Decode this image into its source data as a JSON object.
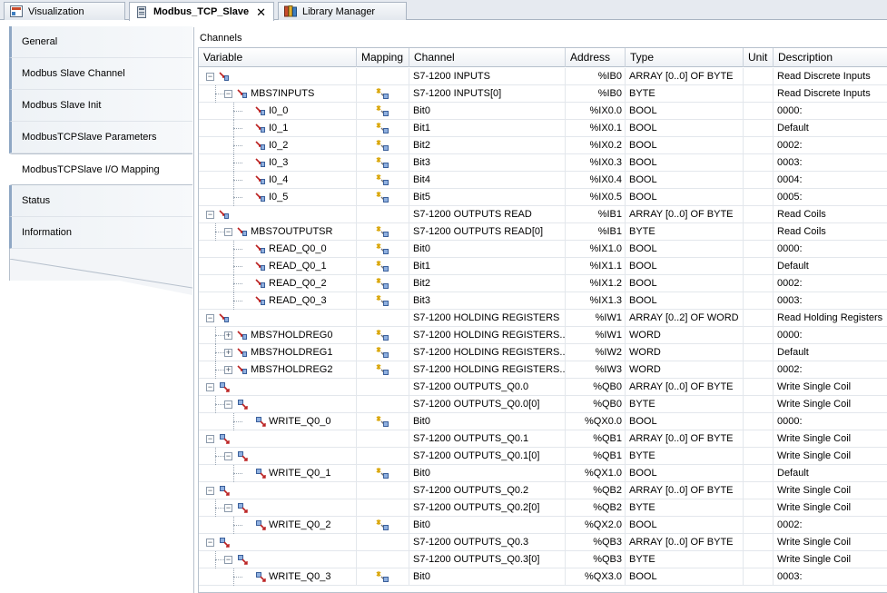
{
  "tabs": [
    {
      "label": "Visualization",
      "icon": "visualization-icon",
      "active": false
    },
    {
      "label": "Modbus_TCP_Slave",
      "icon": "device-icon",
      "active": true
    },
    {
      "label": "Library Manager",
      "icon": "library-icon",
      "active": false
    }
  ],
  "nav": [
    {
      "label": "General"
    },
    {
      "label": "Modbus Slave Channel"
    },
    {
      "label": "Modbus Slave Init"
    },
    {
      "label": "ModbusTCPSlave Parameters"
    },
    {
      "label": "ModbusTCPSlave I/O Mapping"
    },
    {
      "label": "Status"
    },
    {
      "label": "Information"
    }
  ],
  "section_title": "Channels",
  "columns": {
    "variable": "Variable",
    "mapping": "Mapping",
    "channel": "Channel",
    "address": "Address",
    "type": "Type",
    "unit": "Unit",
    "description": "Description"
  },
  "rows": [
    {
      "level": 0,
      "expander": "minus",
      "icon": "input",
      "var": "",
      "map": false,
      "channel": "S7-1200 INPUTS",
      "address": "%IB0",
      "type": "ARRAY [0..0] OF BYTE",
      "unit": "",
      "desc": "Read Discrete Inputs"
    },
    {
      "level": 1,
      "expander": "minus",
      "icon": "input",
      "var": "MBS7INPUTS",
      "map": true,
      "channel": "S7-1200 INPUTS[0]",
      "address": "%IB0",
      "type": "BYTE",
      "unit": "",
      "desc": "Read Discrete Inputs"
    },
    {
      "level": 2,
      "expander": "",
      "icon": "input",
      "var": "I0_0",
      "map": true,
      "channel": "Bit0",
      "address": "%IX0.0",
      "type": "BOOL",
      "unit": "",
      "desc": "0000:"
    },
    {
      "level": 2,
      "expander": "",
      "icon": "input",
      "var": "I0_1",
      "map": true,
      "channel": "Bit1",
      "address": "%IX0.1",
      "type": "BOOL",
      "unit": "",
      "desc": "Default"
    },
    {
      "level": 2,
      "expander": "",
      "icon": "input",
      "var": "I0_2",
      "map": true,
      "channel": "Bit2",
      "address": "%IX0.2",
      "type": "BOOL",
      "unit": "",
      "desc": "0002:"
    },
    {
      "level": 2,
      "expander": "",
      "icon": "input",
      "var": "I0_3",
      "map": true,
      "channel": "Bit3",
      "address": "%IX0.3",
      "type": "BOOL",
      "unit": "",
      "desc": "0003:"
    },
    {
      "level": 2,
      "expander": "",
      "icon": "input",
      "var": "I0_4",
      "map": true,
      "channel": "Bit4",
      "address": "%IX0.4",
      "type": "BOOL",
      "unit": "",
      "desc": "0004:"
    },
    {
      "level": 2,
      "expander": "",
      "icon": "input",
      "var": "I0_5",
      "map": true,
      "channel": "Bit5",
      "address": "%IX0.5",
      "type": "BOOL",
      "unit": "",
      "desc": "0005:"
    },
    {
      "level": 0,
      "expander": "minus",
      "icon": "input",
      "var": "",
      "map": false,
      "channel": "S7-1200 OUTPUTS READ",
      "address": "%IB1",
      "type": "ARRAY [0..0] OF BYTE",
      "unit": "",
      "desc": "Read Coils"
    },
    {
      "level": 1,
      "expander": "minus",
      "icon": "input",
      "var": "MBS7OUTPUTSR",
      "map": true,
      "channel": "S7-1200 OUTPUTS READ[0]",
      "address": "%IB1",
      "type": "BYTE",
      "unit": "",
      "desc": "Read Coils"
    },
    {
      "level": 2,
      "expander": "",
      "icon": "input",
      "var": "READ_Q0_0",
      "map": true,
      "channel": "Bit0",
      "address": "%IX1.0",
      "type": "BOOL",
      "unit": "",
      "desc": "0000:"
    },
    {
      "level": 2,
      "expander": "",
      "icon": "input",
      "var": "READ_Q0_1",
      "map": true,
      "channel": "Bit1",
      "address": "%IX1.1",
      "type": "BOOL",
      "unit": "",
      "desc": "Default"
    },
    {
      "level": 2,
      "expander": "",
      "icon": "input",
      "var": "READ_Q0_2",
      "map": true,
      "channel": "Bit2",
      "address": "%IX1.2",
      "type": "BOOL",
      "unit": "",
      "desc": "0002:"
    },
    {
      "level": 2,
      "expander": "",
      "icon": "input",
      "var": "READ_Q0_3",
      "map": true,
      "channel": "Bit3",
      "address": "%IX1.3",
      "type": "BOOL",
      "unit": "",
      "desc": "0003:"
    },
    {
      "level": 0,
      "expander": "minus",
      "icon": "input",
      "var": "",
      "map": false,
      "channel": "S7-1200 HOLDING REGISTERS",
      "address": "%IW1",
      "type": "ARRAY [0..2] OF WORD",
      "unit": "",
      "desc": "Read Holding Registers"
    },
    {
      "level": 1,
      "expander": "plus",
      "icon": "input",
      "var": "MBS7HOLDREG0",
      "map": true,
      "channel": "S7-1200 HOLDING REGISTERS...",
      "address": "%IW1",
      "type": "WORD",
      "unit": "",
      "desc": "0000:"
    },
    {
      "level": 1,
      "expander": "plus",
      "icon": "input",
      "var": "MBS7HOLDREG1",
      "map": true,
      "channel": "S7-1200 HOLDING REGISTERS...",
      "address": "%IW2",
      "type": "WORD",
      "unit": "",
      "desc": "Default"
    },
    {
      "level": 1,
      "expander": "plus",
      "icon": "input",
      "var": "MBS7HOLDREG2",
      "map": true,
      "channel": "S7-1200 HOLDING REGISTERS...",
      "address": "%IW3",
      "type": "WORD",
      "unit": "",
      "desc": "0002:"
    },
    {
      "level": 0,
      "expander": "minus",
      "icon": "output",
      "var": "",
      "map": false,
      "channel": "S7-1200 OUTPUTS_Q0.0",
      "address": "%QB0",
      "type": "ARRAY [0..0] OF BYTE",
      "unit": "",
      "desc": "Write Single Coil"
    },
    {
      "level": 1,
      "expander": "minus",
      "icon": "output",
      "var": "",
      "map": false,
      "channel": "S7-1200 OUTPUTS_Q0.0[0]",
      "address": "%QB0",
      "type": "BYTE",
      "unit": "",
      "desc": "Write Single Coil"
    },
    {
      "level": 2,
      "expander": "",
      "icon": "output",
      "var": "WRITE_Q0_0",
      "map": true,
      "channel": "Bit0",
      "address": "%QX0.0",
      "type": "BOOL",
      "unit": "",
      "desc": "0000:"
    },
    {
      "level": 0,
      "expander": "minus",
      "icon": "output",
      "var": "",
      "map": false,
      "channel": "S7-1200 OUTPUTS_Q0.1",
      "address": "%QB1",
      "type": "ARRAY [0..0] OF BYTE",
      "unit": "",
      "desc": "Write Single Coil"
    },
    {
      "level": 1,
      "expander": "minus",
      "icon": "output",
      "var": "",
      "map": false,
      "channel": "S7-1200 OUTPUTS_Q0.1[0]",
      "address": "%QB1",
      "type": "BYTE",
      "unit": "",
      "desc": "Write Single Coil"
    },
    {
      "level": 2,
      "expander": "",
      "icon": "output",
      "var": "WRITE_Q0_1",
      "map": true,
      "channel": "Bit0",
      "address": "%QX1.0",
      "type": "BOOL",
      "unit": "",
      "desc": "Default"
    },
    {
      "level": 0,
      "expander": "minus",
      "icon": "output",
      "var": "",
      "map": false,
      "channel": "S7-1200 OUTPUTS_Q0.2",
      "address": "%QB2",
      "type": "ARRAY [0..0] OF BYTE",
      "unit": "",
      "desc": "Write Single Coil"
    },
    {
      "level": 1,
      "expander": "minus",
      "icon": "output",
      "var": "",
      "map": false,
      "channel": "S7-1200 OUTPUTS_Q0.2[0]",
      "address": "%QB2",
      "type": "BYTE",
      "unit": "",
      "desc": "Write Single Coil"
    },
    {
      "level": 2,
      "expander": "",
      "icon": "output",
      "var": "WRITE_Q0_2",
      "map": true,
      "channel": "Bit0",
      "address": "%QX2.0",
      "type": "BOOL",
      "unit": "",
      "desc": "0002:"
    },
    {
      "level": 0,
      "expander": "minus",
      "icon": "output",
      "var": "",
      "map": false,
      "channel": "S7-1200 OUTPUTS_Q0.3",
      "address": "%QB3",
      "type": "ARRAY [0..0] OF BYTE",
      "unit": "",
      "desc": "Write Single Coil"
    },
    {
      "level": 1,
      "expander": "minus",
      "icon": "output",
      "var": "",
      "map": false,
      "channel": "S7-1200 OUTPUTS_Q0.3[0]",
      "address": "%QB3",
      "type": "BYTE",
      "unit": "",
      "desc": "Write Single Coil"
    },
    {
      "level": 2,
      "expander": "",
      "icon": "output",
      "var": "WRITE_Q0_3",
      "map": true,
      "channel": "Bit0",
      "address": "%QX3.0",
      "type": "BOOL",
      "unit": "",
      "desc": "0003:"
    }
  ]
}
